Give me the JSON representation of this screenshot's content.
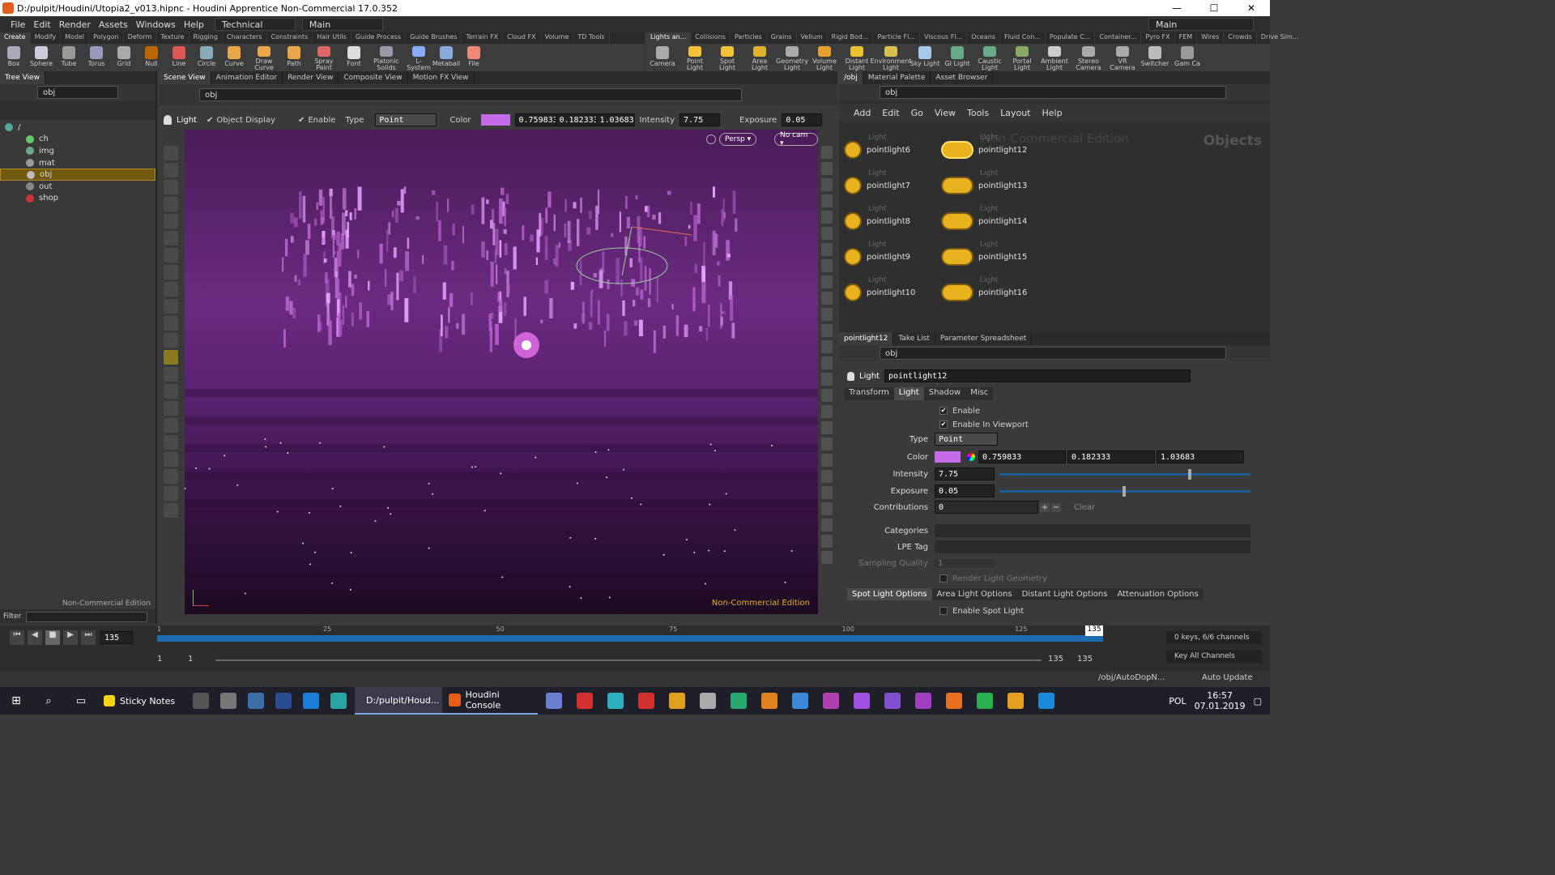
{
  "window": {
    "title": "D:/pulpit/Houdini/Utopia2_v013.hipnc - Houdini Apprentice Non-Commercial 17.0.352"
  },
  "menu": {
    "items": [
      "File",
      "Edit",
      "Render",
      "Assets",
      "Windows",
      "Help"
    ],
    "desktop": "Technical",
    "desktop_main": "Main",
    "right_desk": "Main"
  },
  "shelf_left": {
    "tabs": [
      "Create",
      "Modify",
      "Model",
      "Polygon",
      "Deform",
      "Texture",
      "Rigging",
      "Characters",
      "Constraints",
      "Hair Utils",
      "Guide Process",
      "Guide Brushes",
      "Terrain FX",
      "Cloud FX",
      "Volume",
      "TD Tools"
    ],
    "tools": [
      "Box",
      "Sphere",
      "Tube",
      "Torus",
      "Grid",
      "Null",
      "Line",
      "Circle",
      "Curve",
      "Draw Curve",
      "Path",
      "Spray Paint",
      "Font",
      "Platonic Solids",
      "L-System",
      "Metaball",
      "File"
    ]
  },
  "shelf_right": {
    "tabs": [
      "Lights an...",
      "Collisions",
      "Particles",
      "Grains",
      "Vellum",
      "Rigid Bod...",
      "Particle Fl...",
      "Viscous Fl...",
      "Oceans",
      "Fluid Con...",
      "Populate C...",
      "Container...",
      "Pyro FX",
      "FEM",
      "Wires",
      "Crowds",
      "Drive Sim..."
    ],
    "tools": [
      "Camera",
      "Point Light",
      "Spot Light",
      "Area Light",
      "Geometry Light",
      "Volume Light",
      "Distant Light",
      "Environment Light",
      "Sky Light",
      "GI Light",
      "Caustic Light",
      "Portal Light",
      "Ambient Light",
      "Stereo Camera",
      "VR Camera",
      "Switcher",
      "Gam Ca"
    ]
  },
  "tree": {
    "tab": "Tree View",
    "path": "obj",
    "root": "/",
    "items": [
      "ch",
      "img",
      "mat",
      "obj",
      "out",
      "shop"
    ],
    "selected": "obj",
    "watermark": "Non-Commercial Edition",
    "filter_label": "Filter"
  },
  "scene": {
    "tabs": [
      "Scene View",
      "Animation Editor",
      "Render View",
      "Composite View",
      "Motion FX View"
    ],
    "path": "obj",
    "light_label": "Light",
    "object_display": "Object Display",
    "enable": "Enable",
    "type_label": "Type",
    "type_value": "Point",
    "color_label": "Color",
    "color_r": "0.759833",
    "color_g": "0.182333",
    "color_b": "1.03683",
    "intensity_label": "Intensity",
    "intensity": "7.75",
    "exposure_label": "Exposure",
    "exposure": "0.05",
    "persp": "Persp ▾",
    "cam": "No cam ▾",
    "watermark": "Non-Commercial Edition"
  },
  "network": {
    "tabs": [
      "/obj",
      "Material Palette",
      "Asset Browser"
    ],
    "path": "obj",
    "menu": [
      "Add",
      "Edit",
      "Go",
      "View",
      "Tools",
      "Layout",
      "Help"
    ],
    "watermark": "Non-Commercial Edition",
    "context": "Objects",
    "node_type": "Light",
    "nodes_left": [
      "pointlight6",
      "pointlight7",
      "pointlight8",
      "pointlight9",
      "pointlight10"
    ],
    "nodes_right": [
      "pointlight12",
      "pointlight13",
      "pointlight14",
      "pointlight15",
      "pointlight16"
    ]
  },
  "params": {
    "tabs": [
      "pointlight12",
      "Take List",
      "Parameter Spreadsheet"
    ],
    "path": "obj",
    "node_type": "Light",
    "node_name": "pointlight12",
    "folders": [
      "Transform",
      "Light",
      "Shadow",
      "Misc"
    ],
    "enable": "Enable",
    "enable_viewport": "Enable In Viewport",
    "type_label": "Type",
    "type": "Point",
    "color_label": "Color",
    "r": "0.759833",
    "g": "0.182333",
    "b": "1.03683",
    "intensity_label": "Intensity",
    "intensity": "7.75",
    "intensity_level": 0.75,
    "exposure_label": "Exposure",
    "exposure": "0.05",
    "exposure_level": 0.49,
    "contributions_label": "Contributions",
    "contributions": "0",
    "clear": "Clear",
    "categories_label": "Categories",
    "lpe_label": "LPE Tag",
    "sampling_label": "Sampling Quality",
    "sampling": "1",
    "render_geo": "Render Light Geometry",
    "sub_tabs": [
      "Spot Light Options",
      "Area Light Options",
      "Distant Light Options",
      "Attenuation Options"
    ],
    "spot": "Enable Spot Light"
  },
  "timeline": {
    "frame": "135",
    "start": "1",
    "start2": "1",
    "end": "135",
    "end2": "135",
    "marker": "135",
    "ticks": [
      "1",
      "25",
      "50",
      "75",
      "100",
      "125"
    ],
    "keys": "0 keys, 6/6 channels",
    "key_all": "Key All Channels"
  },
  "status": {
    "path": "/obj/AutoDopN...",
    "update": "Auto Update"
  },
  "taskbar": {
    "apps": [
      "Sticky Notes",
      "D:/pulpit/Houd...",
      "Houdini Console"
    ],
    "lang": "POL",
    "time": "16:57",
    "date": "07.01.2019"
  },
  "colors": {
    "light_color": "#c46ce8",
    "accent": "#e8b11e",
    "viewport": "#5a2270",
    "selection": "#705a10"
  }
}
